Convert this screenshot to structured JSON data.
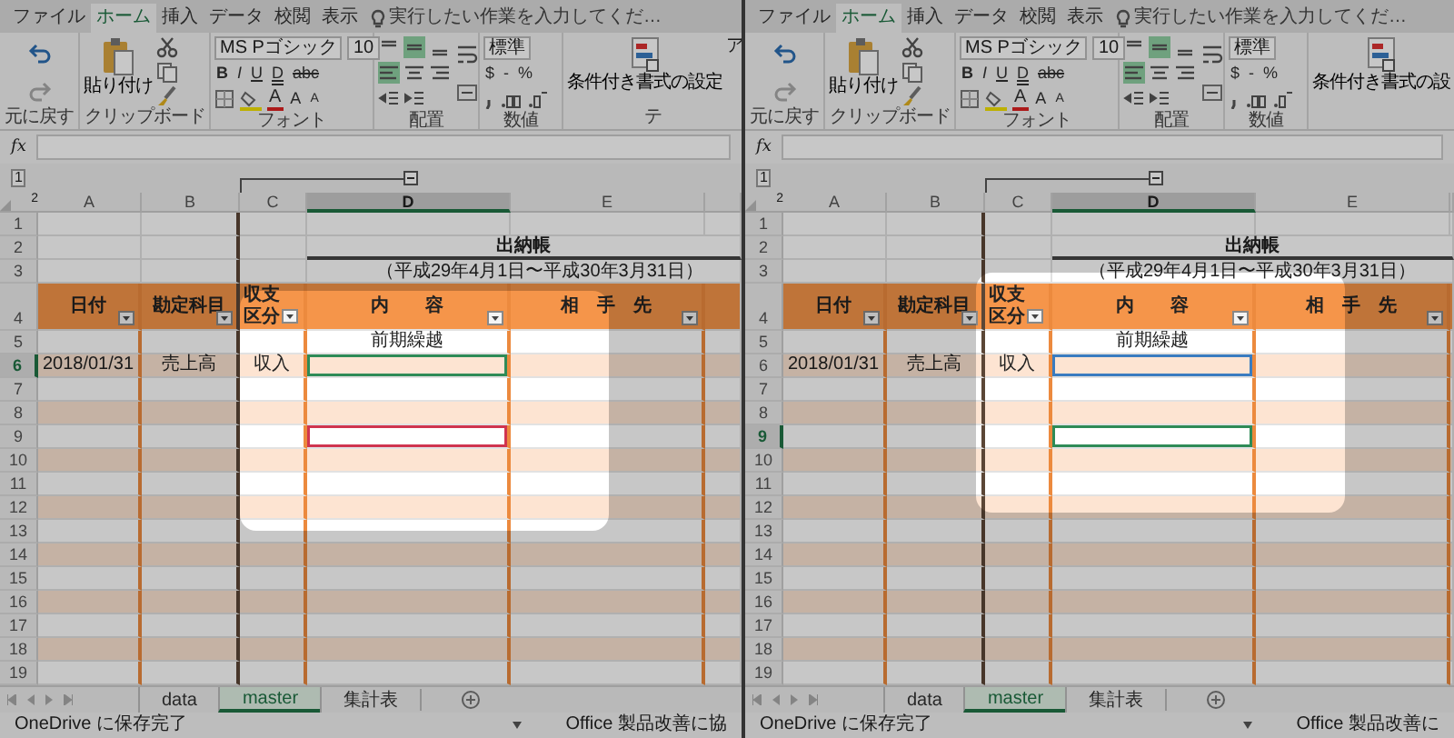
{
  "panels": [
    {
      "ribbon_tabs": [
        {
          "label": "ファイル",
          "selected": false
        },
        {
          "label": "ホーム",
          "selected": true
        },
        {
          "label": "挿入",
          "selected": false
        },
        {
          "label": "データ",
          "selected": false
        },
        {
          "label": "校閲",
          "selected": false
        },
        {
          "label": "表示",
          "selected": false
        }
      ],
      "tell_me": "実行したい作業を入力してくだ…",
      "undo_label": "元に戻す",
      "paste_label": "貼り付け",
      "clipboard_label": "クリップボード",
      "font_name": "MS Pゴシック",
      "font_size": "10",
      "format_buttons": [
        "B",
        "I",
        "U",
        "D",
        "abc"
      ],
      "font_color_button": "A",
      "grow_button": "A",
      "shrink_button": "A",
      "font_label": "フォント",
      "align_buttons": [
        {
          "selected": false
        },
        {
          "selected": true
        },
        {
          "selected": false
        },
        {
          "selected": true
        },
        {
          "selected": false
        },
        {
          "selected": false
        }
      ],
      "alignment_label": "配置",
      "number_format": "標準",
      "number_buttons": [
        "$",
        "-",
        "%"
      ],
      "number_label": "数値",
      "conditional_label": "条件付き書式の設定",
      "extra_label": "ア",
      "cut_group_label": "テ",
      "formula_label": "fx",
      "outline_levels": [
        "1",
        "2"
      ],
      "columns": [
        {
          "label": "A",
          "selected": false
        },
        {
          "label": "B",
          "selected": false
        },
        {
          "label": "C",
          "selected": false
        },
        {
          "label": "D",
          "selected": true
        },
        {
          "label": "E",
          "selected": false
        }
      ],
      "rows": [
        {
          "label": "1",
          "selected": false
        },
        {
          "label": "2",
          "selected": false,
          "title": "出納帳"
        },
        {
          "label": "3",
          "selected": false,
          "period": "（平成29年4月1日〜平成30年3月31日）"
        },
        {
          "label": "4",
          "selected": false,
          "headers": [
            "日付",
            "勘定科目",
            [
              "収支",
              "区分"
            ],
            "内　　容",
            "相　手　先"
          ]
        },
        {
          "label": "5",
          "selected": false,
          "cells": {
            "d": "前期繰越"
          }
        },
        {
          "label": "6",
          "selected": true,
          "cells": {
            "a": "2018/01/31",
            "b": "売上高",
            "c": "収入"
          },
          "color": "#2e8b57"
        },
        {
          "label": "7",
          "selected": false
        },
        {
          "label": "8",
          "selected": false
        },
        {
          "label": "9",
          "selected": false,
          "color": "#d0344f"
        },
        {
          "label": "10",
          "selected": false
        },
        {
          "label": "11",
          "selected": false
        },
        {
          "label": "12",
          "selected": false
        },
        {
          "label": "13",
          "selected": false
        },
        {
          "label": "14",
          "selected": false
        },
        {
          "label": "15",
          "selected": false
        },
        {
          "label": "16",
          "selected": false
        },
        {
          "label": "17",
          "selected": false
        },
        {
          "label": "18",
          "selected": false
        },
        {
          "label": "19",
          "selected": false
        }
      ],
      "sheet_tabs": [
        {
          "label": "data",
          "selected": false
        },
        {
          "label": "master",
          "selected": true
        },
        {
          "label": "集計表",
          "selected": false
        }
      ],
      "status": "OneDrive に保存完了",
      "status_right": "Office 製品改善に協"
    },
    {
      "ribbon_tabs": [
        {
          "label": "ファイル",
          "selected": false
        },
        {
          "label": "ホーム",
          "selected": true
        },
        {
          "label": "挿入",
          "selected": false
        },
        {
          "label": "データ",
          "selected": false
        },
        {
          "label": "校閲",
          "selected": false
        },
        {
          "label": "表示",
          "selected": false
        }
      ],
      "tell_me": "実行したい作業を入力してくだ…",
      "undo_label": "元に戻す",
      "paste_label": "貼り付け",
      "clipboard_label": "クリップボード",
      "font_name": "MS Pゴシック",
      "font_size": "10",
      "format_buttons": [
        "B",
        "I",
        "U",
        "D",
        "abc"
      ],
      "font_color_button": "A",
      "grow_button": "A",
      "shrink_button": "A",
      "font_label": "フォント",
      "align_buttons": [
        {
          "selected": false
        },
        {
          "selected": true
        },
        {
          "selected": false
        },
        {
          "selected": true
        },
        {
          "selected": false
        },
        {
          "selected": false
        }
      ],
      "alignment_label": "配置",
      "number_format": "標準",
      "number_buttons": [
        "$",
        "-",
        "%"
      ],
      "number_label": "数値",
      "conditional_label": "条件付き書式の設",
      "formula_label": "fx",
      "outline_levels": [
        "1",
        "2"
      ],
      "columns": [
        {
          "label": "A",
          "selected": false
        },
        {
          "label": "B",
          "selected": false
        },
        {
          "label": "C",
          "selected": false
        },
        {
          "label": "D",
          "selected": true
        },
        {
          "label": "E",
          "selected": false
        }
      ],
      "rows": [
        {
          "label": "1",
          "selected": false
        },
        {
          "label": "2",
          "selected": false,
          "title": "出納帳"
        },
        {
          "label": "3",
          "selected": false,
          "period": "（平成29年4月1日〜平成30年3月31日）"
        },
        {
          "label": "4",
          "selected": false,
          "headers": [
            "日付",
            "勘定科目",
            [
              "収支",
              "区分"
            ],
            "内　　容",
            "相　手　先"
          ]
        },
        {
          "label": "5",
          "selected": false,
          "cells": {
            "d": "前期繰越"
          }
        },
        {
          "label": "6",
          "selected": false,
          "cells": {
            "a": "2018/01/31",
            "b": "売上高",
            "c": "収入"
          },
          "color": "#3a7cc0"
        },
        {
          "label": "7",
          "selected": false
        },
        {
          "label": "8",
          "selected": false
        },
        {
          "label": "9",
          "selected": true,
          "color": "#2e8b57"
        },
        {
          "label": "10",
          "selected": false
        },
        {
          "label": "11",
          "selected": false
        },
        {
          "label": "12",
          "selected": false
        },
        {
          "label": "13",
          "selected": false
        },
        {
          "label": "14",
          "selected": false
        },
        {
          "label": "15",
          "selected": false
        },
        {
          "label": "16",
          "selected": false
        },
        {
          "label": "17",
          "selected": false
        },
        {
          "label": "18",
          "selected": false
        },
        {
          "label": "19",
          "selected": false
        }
      ],
      "sheet_tabs": [
        {
          "label": "data",
          "selected": false
        },
        {
          "label": "master",
          "selected": true
        },
        {
          "label": "集計表",
          "selected": false
        }
      ],
      "status": "OneDrive に保存完了",
      "status_right": "Office 製品改善に"
    }
  ]
}
